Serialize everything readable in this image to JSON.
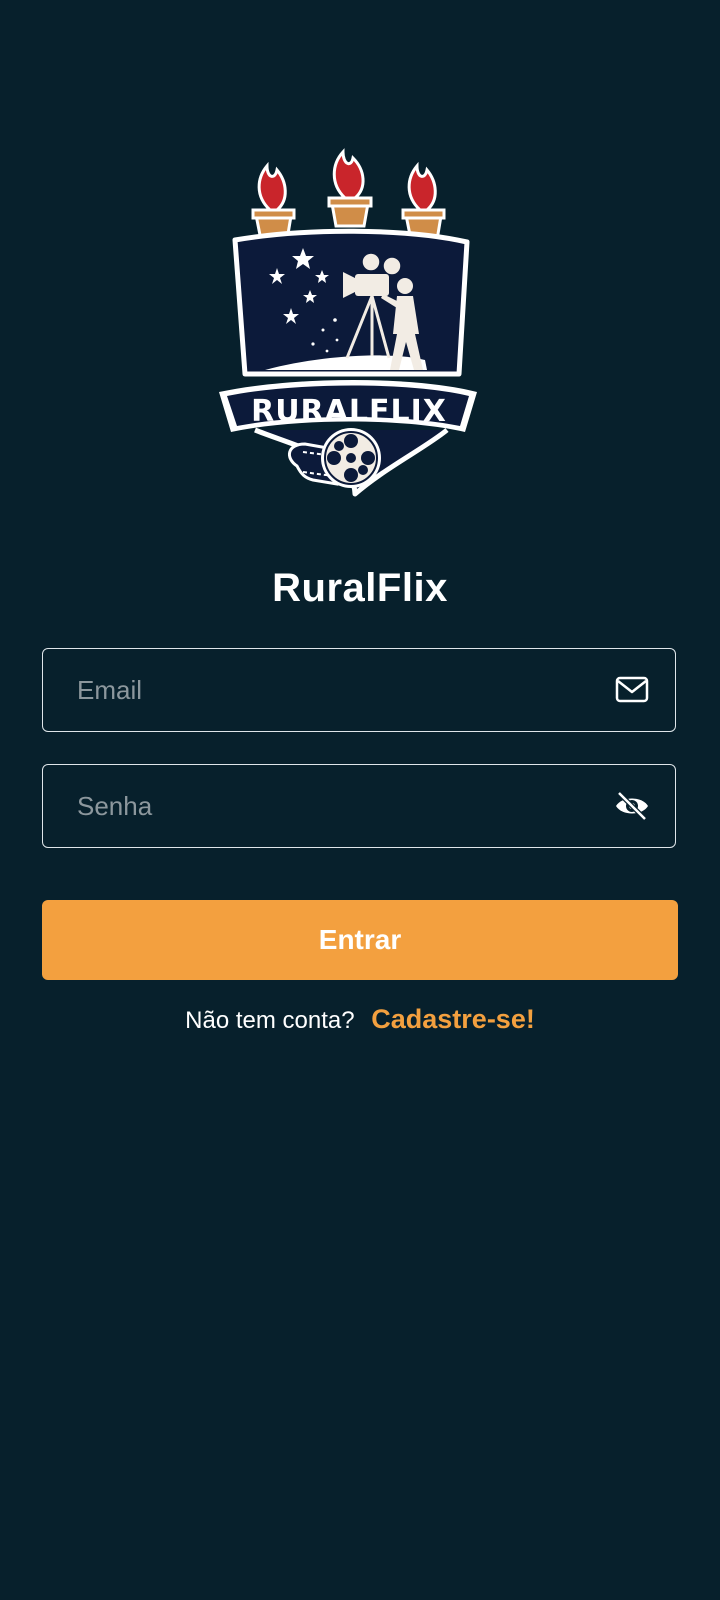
{
  "logo": {
    "name": "ruralflix-crest-logo",
    "text": "RURALFLIX",
    "colors": {
      "flame": "#c9252b",
      "torch": "#d08d48",
      "shield": "#0c1a3a",
      "outline": "#ffffff"
    }
  },
  "app": {
    "title": "RuralFlix"
  },
  "form": {
    "email": {
      "placeholder": "Email",
      "icon": "envelope-icon"
    },
    "password": {
      "placeholder": "Senha",
      "icon": "eye-off-icon"
    },
    "submit_label": "Entrar"
  },
  "signup": {
    "prompt": "Não tem conta?",
    "link_label": "Cadastre-se!"
  },
  "colors": {
    "background": "#07202c",
    "accent": "#f3a03f",
    "text": "#ffffff",
    "placeholder": "#8c979d"
  }
}
